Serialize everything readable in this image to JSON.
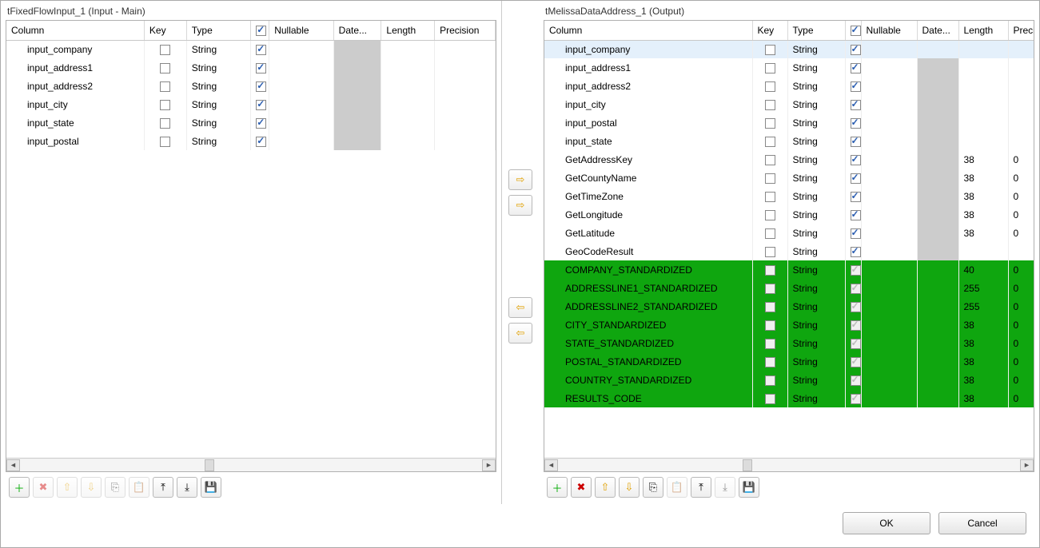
{
  "leftPanel": {
    "title": "tFixedFlowInput_1 (Input - Main)",
    "headers": {
      "column": "Column",
      "key": "Key",
      "type": "Type",
      "nullable": "Nullable",
      "date": "Date...",
      "length": "Length",
      "precision": "Precision"
    },
    "rows": [
      {
        "column": "input_company",
        "key": false,
        "type": "String",
        "nullable": true,
        "date": "gray",
        "length": "",
        "precision": ""
      },
      {
        "column": "input_address1",
        "key": false,
        "type": "String",
        "nullable": true,
        "date": "gray",
        "length": "",
        "precision": ""
      },
      {
        "column": "input_address2",
        "key": false,
        "type": "String",
        "nullable": true,
        "date": "gray",
        "length": "",
        "precision": ""
      },
      {
        "column": "input_city",
        "key": false,
        "type": "String",
        "nullable": true,
        "date": "gray",
        "length": "",
        "precision": ""
      },
      {
        "column": "input_state",
        "key": false,
        "type": "String",
        "nullable": true,
        "date": "gray",
        "length": "",
        "precision": ""
      },
      {
        "column": "input_postal",
        "key": false,
        "type": "String",
        "nullable": true,
        "date": "gray",
        "length": "",
        "precision": ""
      }
    ]
  },
  "rightPanel": {
    "title": "tMelissaDataAddress_1 (Output)",
    "headers": {
      "column": "Column",
      "key": "Key",
      "type": "Type",
      "nullable": "Nullable",
      "date": "Date...",
      "length": "Length",
      "precision": "Precision"
    },
    "rows": [
      {
        "column": "input_company",
        "key": false,
        "type": "String",
        "nullable": true,
        "date": "",
        "length": "",
        "precision": "",
        "style": "selected"
      },
      {
        "column": "input_address1",
        "key": false,
        "type": "String",
        "nullable": true,
        "date": "gray",
        "length": "",
        "precision": ""
      },
      {
        "column": "input_address2",
        "key": false,
        "type": "String",
        "nullable": true,
        "date": "gray",
        "length": "",
        "precision": ""
      },
      {
        "column": "input_city",
        "key": false,
        "type": "String",
        "nullable": true,
        "date": "gray",
        "length": "",
        "precision": ""
      },
      {
        "column": "input_postal",
        "key": false,
        "type": "String",
        "nullable": true,
        "date": "gray",
        "length": "",
        "precision": ""
      },
      {
        "column": "input_state",
        "key": false,
        "type": "String",
        "nullable": true,
        "date": "gray",
        "length": "",
        "precision": ""
      },
      {
        "column": "GetAddressKey",
        "key": false,
        "type": "String",
        "nullable": true,
        "date": "gray",
        "length": "38",
        "precision": "0"
      },
      {
        "column": "GetCountyName",
        "key": false,
        "type": "String",
        "nullable": true,
        "date": "gray",
        "length": "38",
        "precision": "0"
      },
      {
        "column": "GetTimeZone",
        "key": false,
        "type": "String",
        "nullable": true,
        "date": "gray",
        "length": "38",
        "precision": "0"
      },
      {
        "column": "GetLongitude",
        "key": false,
        "type": "String",
        "nullable": true,
        "date": "gray",
        "length": "38",
        "precision": "0"
      },
      {
        "column": "GetLatitude",
        "key": false,
        "type": "String",
        "nullable": true,
        "date": "gray",
        "length": "38",
        "precision": "0"
      },
      {
        "column": "GeoCodeResult",
        "key": false,
        "type": "String",
        "nullable": true,
        "date": "gray",
        "length": "",
        "precision": ""
      },
      {
        "column": "COMPANY_STANDARDIZED",
        "key": false,
        "type": "String",
        "nullable": true,
        "date": "",
        "length": "40",
        "precision": "0",
        "style": "green"
      },
      {
        "column": "ADDRESSLINE1_STANDARDIZED",
        "key": false,
        "type": "String",
        "nullable": true,
        "date": "",
        "length": "255",
        "precision": "0",
        "style": "green"
      },
      {
        "column": "ADDRESSLINE2_STANDARDIZED",
        "key": false,
        "type": "String",
        "nullable": true,
        "date": "",
        "length": "255",
        "precision": "0",
        "style": "green"
      },
      {
        "column": "CITY_STANDARDIZED",
        "key": false,
        "type": "String",
        "nullable": true,
        "date": "",
        "length": "38",
        "precision": "0",
        "style": "green"
      },
      {
        "column": "STATE_STANDARDIZED",
        "key": false,
        "type": "String",
        "nullable": true,
        "date": "",
        "length": "38",
        "precision": "0",
        "style": "green"
      },
      {
        "column": "POSTAL_STANDARDIZED",
        "key": false,
        "type": "String",
        "nullable": true,
        "date": "",
        "length": "38",
        "precision": "0",
        "style": "green"
      },
      {
        "column": "COUNTRY_STANDARDIZED",
        "key": false,
        "type": "String",
        "nullable": true,
        "date": "",
        "length": "38",
        "precision": "0",
        "style": "green"
      },
      {
        "column": "RESULTS_CODE",
        "key": false,
        "type": "String",
        "nullable": true,
        "date": "",
        "length": "38",
        "precision": "0",
        "style": "green"
      }
    ]
  },
  "midArrows": {
    "right": "⇨",
    "rightAll": "⇨",
    "left": "⇦",
    "leftAll": "⇦"
  },
  "toolbarGlyphs": {
    "add": "＋",
    "delete": "✖",
    "up": "⇧",
    "down": "⇩",
    "copy": "⎘",
    "paste": "📋",
    "import": "⤒",
    "export": "⤓",
    "save": "💾"
  },
  "footer": {
    "ok": "OK",
    "cancel": "Cancel"
  }
}
